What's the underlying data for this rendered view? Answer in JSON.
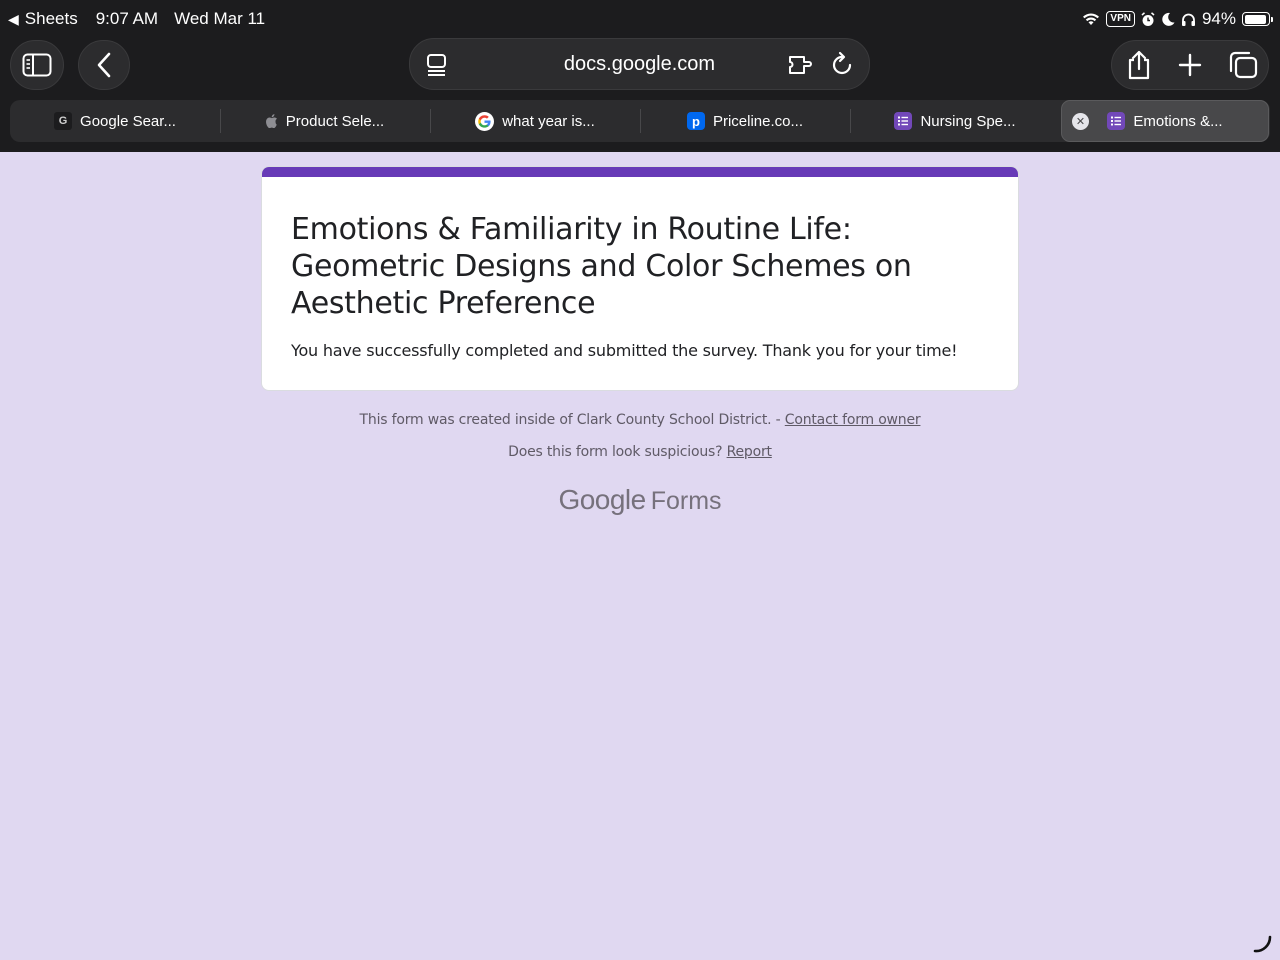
{
  "status_bar": {
    "back_app": "Sheets",
    "time": "9:07 AM",
    "date": "Wed Mar 11",
    "vpn": "VPN",
    "battery": "94%",
    "battery_level": 0.94
  },
  "address_bar": {
    "url": "docs.google.com"
  },
  "tabs": [
    {
      "label": "Google Sear...",
      "favicon": "G"
    },
    {
      "label": "Product Sele...",
      "favicon": "apple-icon"
    },
    {
      "label": "what year is...",
      "favicon": "google-g-icon"
    },
    {
      "label": "Priceline.co...",
      "favicon": "p"
    },
    {
      "label": "Nursing Spe...",
      "favicon": "forms-icon"
    },
    {
      "label": "Emotions &...",
      "favicon": "forms-icon",
      "active": true
    }
  ],
  "form": {
    "title": "Emotions & Familiarity in Routine Life: Geometric Designs and Color Schemes on Aesthetic Preference",
    "message": "You have successfully completed and submitted the survey. Thank you for your time!"
  },
  "footer": {
    "created_text": "This form was created inside of Clark County School District. - ",
    "contact_link": "Contact form owner",
    "suspicious_text": "Does this form look suspicious? ",
    "report_link": "Report",
    "brand_google": "Google",
    "brand_forms": "Forms"
  },
  "colors": {
    "page_bg": "#e0d8f1",
    "accent": "#673ab7",
    "chrome_bg": "#1c1c1e"
  }
}
